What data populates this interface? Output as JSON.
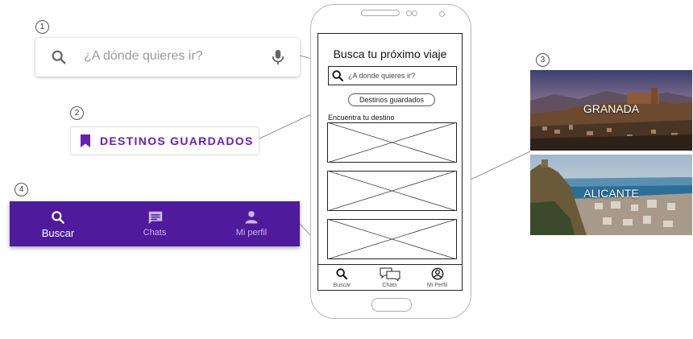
{
  "callouts": [
    "1",
    "2",
    "3",
    "4"
  ],
  "search": {
    "placeholder": "¿A dónde quieres ir?",
    "icons": [
      "search-icon",
      "mic-icon"
    ]
  },
  "saved": {
    "label": "DESTINOS GUARDADOS",
    "icon": "bookmark-icon"
  },
  "bottom_nav": {
    "items": [
      {
        "label": "Buscar",
        "icon": "search-icon",
        "active": true
      },
      {
        "label": "Chats",
        "icon": "chat-icon",
        "active": false
      },
      {
        "label": "Mi perfil",
        "icon": "person-icon",
        "active": false
      }
    ]
  },
  "phone": {
    "title": "Busca tu próximo viaje",
    "search_placeholder": "¿A donde quieres ir?",
    "saved_pill": "Destinos guardados",
    "section_label": "Encuentra tu destino",
    "nav": [
      {
        "label": "Buscar",
        "icon": "search-icon"
      },
      {
        "label": "Chats",
        "icon": "chat-icon"
      },
      {
        "label": "Mi Perfil",
        "icon": "person-icon"
      }
    ]
  },
  "destinations": [
    {
      "name": "GRANADA"
    },
    {
      "name": "ALICANTE"
    }
  ],
  "colors": {
    "accent": "#6a1fb5",
    "nav_bg": "#4f1a9c",
    "nav_inactive": "#c9b6e6"
  }
}
